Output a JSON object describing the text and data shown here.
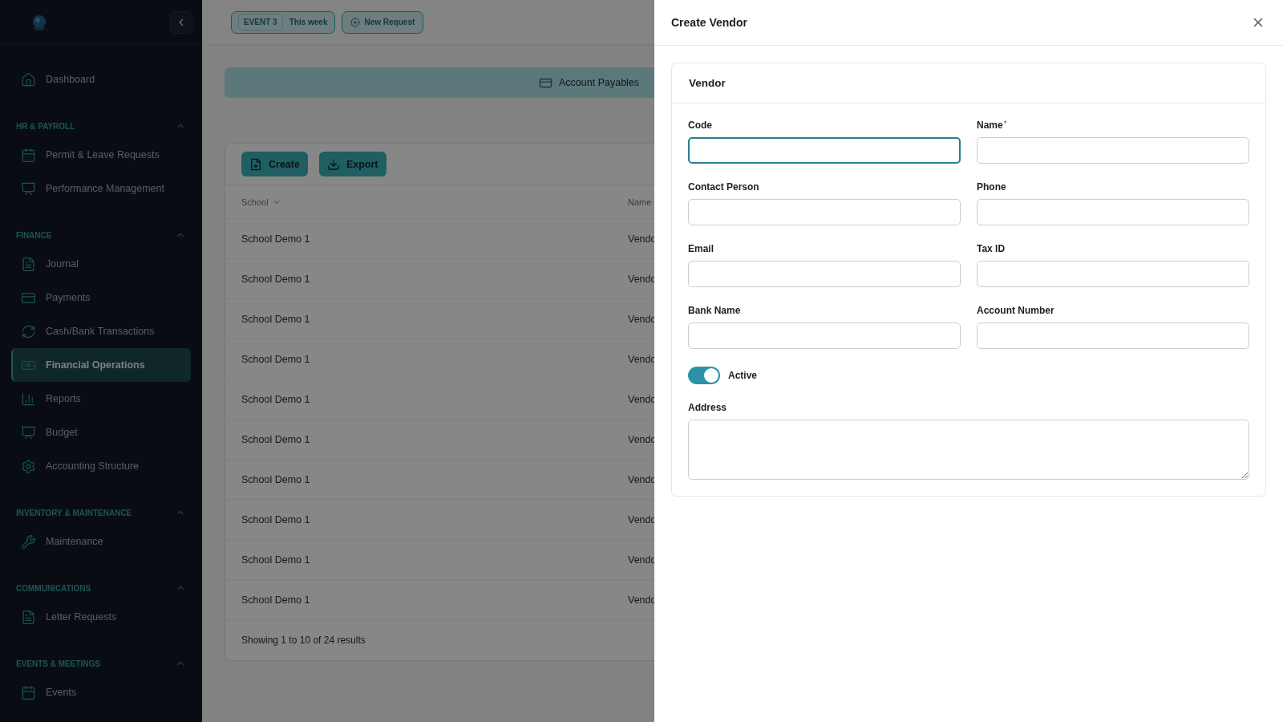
{
  "sidebar": {
    "collapse_button": "‹",
    "top_items": [
      {
        "label": "Dashboard",
        "selected": false
      }
    ],
    "sections": [
      {
        "title": "HR & PAYROLL",
        "expanded": true,
        "items": [
          {
            "label": "Permit & Leave Requests",
            "selected": false
          },
          {
            "label": "Performance Management",
            "selected": false
          }
        ]
      },
      {
        "title": "FINANCE",
        "expanded": true,
        "items": [
          {
            "label": "Journal",
            "selected": false
          },
          {
            "label": "Payments",
            "selected": false
          },
          {
            "label": "Cash/Bank Transactions",
            "selected": false
          },
          {
            "label": "Financial Operations",
            "selected": true
          },
          {
            "label": "Reports",
            "selected": false
          },
          {
            "label": "Budget",
            "selected": false
          },
          {
            "label": "Accounting Structure",
            "selected": false
          }
        ]
      },
      {
        "title": "INVENTORY & MAINTENANCE",
        "expanded": true,
        "items": [
          {
            "label": "Maintenance",
            "selected": false
          }
        ]
      },
      {
        "title": "COMMUNICATIONS",
        "expanded": true,
        "items": [
          {
            "label": "Letter Requests",
            "selected": false
          }
        ]
      },
      {
        "title": "EVENTS & MEETINGS",
        "expanded": true,
        "items": [
          {
            "label": "Events",
            "selected": false
          }
        ]
      }
    ]
  },
  "topbar": {
    "event_badge": "EVENT 3",
    "event_label": "This week",
    "new_request": "New Request"
  },
  "banner": {
    "label": "Account Payables"
  },
  "table": {
    "actions": [
      "Create",
      "Export"
    ],
    "columns": [
      "School",
      "Name"
    ],
    "rows": [
      {
        "school": "School Demo 1",
        "name": "Vendo"
      },
      {
        "school": "School Demo 1",
        "name": "Vendo"
      },
      {
        "school": "School Demo 1",
        "name": "Vendo"
      },
      {
        "school": "School Demo 1",
        "name": "Vendo"
      },
      {
        "school": "School Demo 1",
        "name": "Vendo"
      },
      {
        "school": "School Demo 1",
        "name": "Vendo"
      },
      {
        "school": "School Demo 1",
        "name": "Vendo"
      },
      {
        "school": "School Demo 1",
        "name": "Vendo"
      },
      {
        "school": "School Demo 1",
        "name": "Vendo"
      },
      {
        "school": "School Demo 1",
        "name": "Vendo"
      }
    ],
    "footer": "Showing 1 to 10 of 24 results"
  },
  "drawer": {
    "title": "Create Vendor",
    "card_title": "Vendor",
    "fields": [
      {
        "label": "Code",
        "focused": true
      },
      {
        "label": "Name",
        "required_mark": "*",
        "focused": false
      },
      {
        "label": "Contact Person",
        "focused": false
      },
      {
        "label": "Phone",
        "focused": false
      },
      {
        "label": "Email",
        "focused": false
      },
      {
        "label": "Tax ID",
        "focused": false
      },
      {
        "label": "Bank Name",
        "focused": false
      },
      {
        "label": "Account Number",
        "focused": false
      }
    ],
    "active": {
      "label": "Active",
      "on": true
    },
    "address": {
      "label": "Address"
    }
  }
}
